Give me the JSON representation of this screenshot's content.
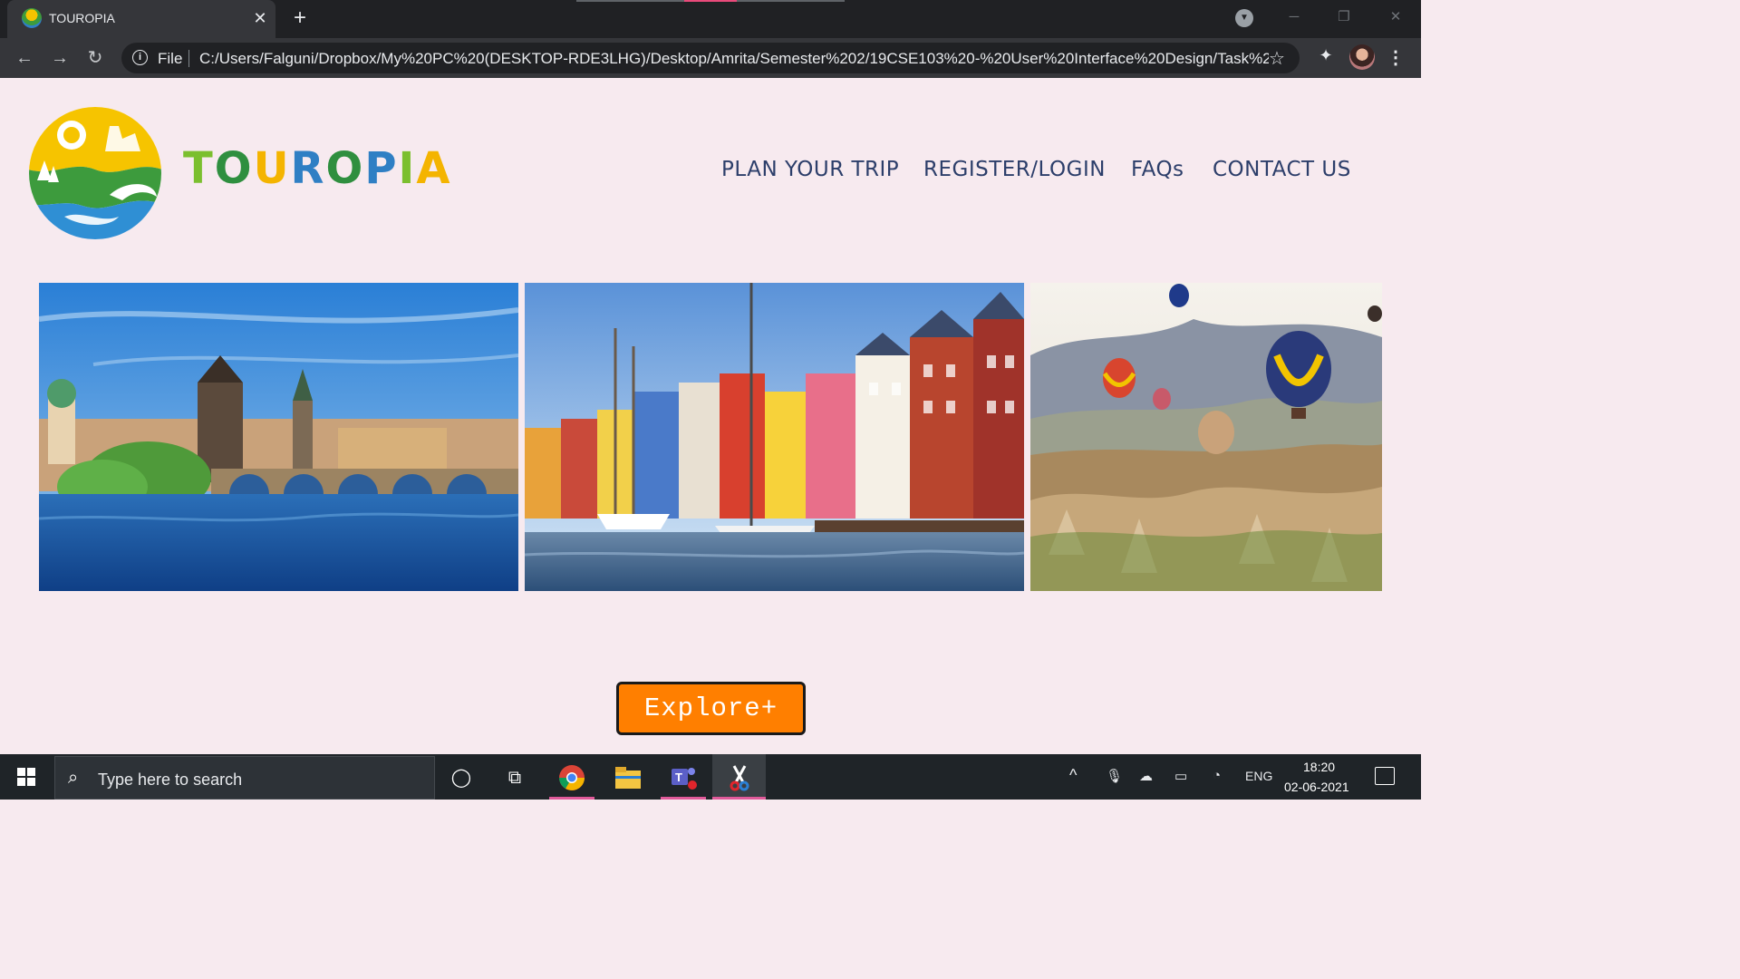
{
  "browser": {
    "tab_title": "TOUROPIA",
    "tab_close": "✕",
    "new_tab": "+",
    "omnibox_scheme": "File",
    "url": "C:/Users/Falguni/Dropbox/My%20PC%20(DESKTOP-RDE3LHG)/Desktop/Amrita/Semester%202/19CSE103%20-%20User%20Interface%20Design/Task%2..."
  },
  "site": {
    "brand_letters": [
      "T",
      "O",
      "U",
      "R",
      "O",
      "P",
      "I",
      "A"
    ],
    "brand_colors": [
      "#7bbf2e",
      "#2f8f3f",
      "#f4b400",
      "#2f7fc4",
      "#2f8f3f",
      "#2f7fc4",
      "#7bbf2e",
      "#f4b400"
    ],
    "nav": {
      "plan": "PLAN YOUR TRIP",
      "register": "REGISTER/LOGIN",
      "faqs": "FAQs",
      "contact": "CONTACT US"
    },
    "explore_label": "Explore+",
    "nav_color": "#2c3e6a",
    "accent": "#ff7f00"
  },
  "taskbar": {
    "search_placeholder": "Type here to search",
    "language": "ENG",
    "time": "18:20",
    "date": "02-06-2021"
  }
}
